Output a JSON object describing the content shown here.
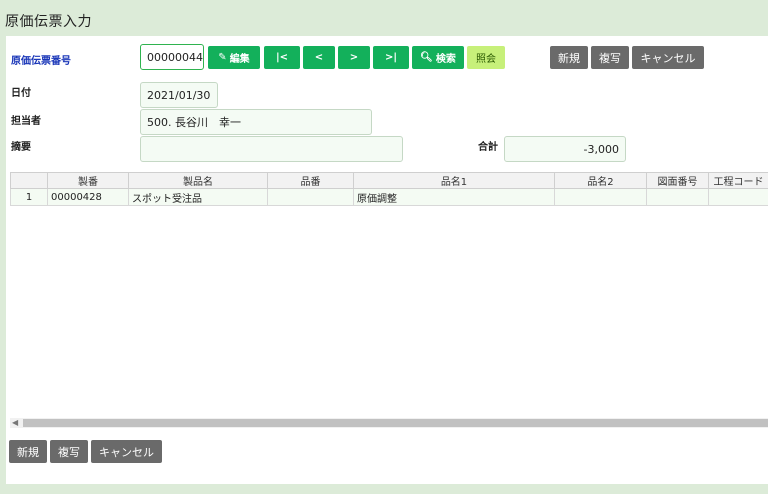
{
  "page": {
    "title": "原価伝票入力"
  },
  "form": {
    "voucher_no_label": "原価伝票番号",
    "voucher_no_value": "00000044",
    "date_label": "日付",
    "date_value": "2021/01/30",
    "person_label": "担当者",
    "person_value": "500. 長谷川　幸一",
    "summary_label": "摘要",
    "summary_value": "",
    "total_label": "合計",
    "total_value": "-3,000"
  },
  "toolbar": {
    "edit": "編集",
    "first": "|<",
    "prev": "<",
    "next": ">",
    "last": ">|",
    "search": "検索",
    "inquiry": "照会"
  },
  "actions_top": {
    "new": "新規",
    "copy": "複写",
    "cancel": "キャンセル"
  },
  "actions_bottom": {
    "new": "新規",
    "copy": "複写",
    "cancel": "キャンセル"
  },
  "grid": {
    "columns": [
      "",
      "製番",
      "製品名",
      "品番",
      "品名1",
      "品名2",
      "図面番号",
      "工程コード"
    ],
    "rows": [
      [
        "1",
        "00000428",
        "スポット受注品",
        "",
        "原価調整",
        "",
        "",
        ""
      ]
    ]
  },
  "icons": {
    "edit": "edit-icon",
    "search": "search-icon"
  },
  "colors": {
    "accent": "#13b05b",
    "background": "#dcebd8",
    "inquiry": "#c7f07a",
    "neutral_button": "#6a6a6a"
  }
}
